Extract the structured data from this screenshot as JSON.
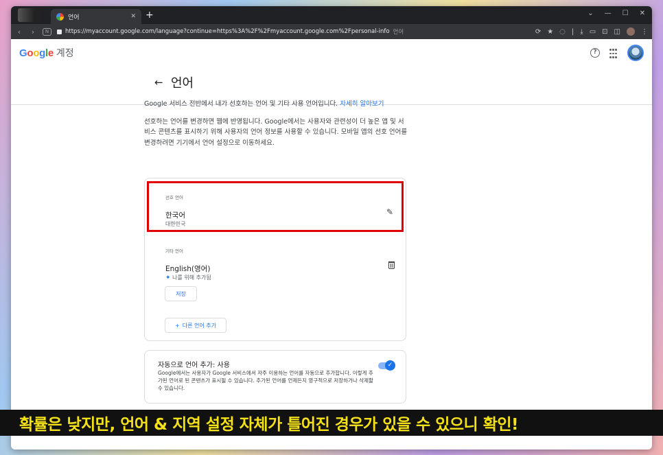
{
  "browser": {
    "tab_title": "언어",
    "new_tab": "+",
    "url": "https://myaccount.google.com/language?continue=https%3A%2F%2Fmyaccount.google.com%2Fpersonal-info",
    "url_suffix": "언어"
  },
  "header": {
    "logo": {
      "G": "G",
      "o1": "o",
      "o2": "o",
      "g": "g",
      "l": "l",
      "e": "e"
    },
    "account": "계정"
  },
  "page": {
    "title": "언어",
    "intro": "Google 서비스 전반에서 내가 선호하는 언어 및 기타 사용 언어입니다.",
    "intro_link": "자세히 알아보기",
    "description": "선호하는 언어를 변경하면 웹에 반영됩니다. Google에서는 사용자와 관련성이 더 높은 앱 및 서비스 콘텐츠를 표시하기 위해 사용자의 언어 정보를 사용할 수 있습니다. 모바일 앱의 선호 언어를 변경하려면 기기에서 언어 설정으로 이동하세요."
  },
  "preferred": {
    "label": "선호 언어",
    "language": "한국어",
    "region": "대한민국"
  },
  "other": {
    "label": "기타 언어",
    "language": "English(영어)",
    "added_note": "나를 위해 추가됨",
    "save_label": "저장",
    "add_label": "다른 언어 추가"
  },
  "auto_add": {
    "title": "자동으로 언어 추가: 사용",
    "description": "Google에서는 사용자가 Google 서비스에서 자주 이용하는 언어를 자동으로 추가합니다. 이렇게 추가된 언어로 된 콘텐츠가 표시될 수 있습니다. 추가된 언어를 언제든지 영구적으로 저장하거나 삭제할 수 있습니다.",
    "enabled": true
  },
  "caption": "확률은 낮지만, 언어 & 지역 설정 자체가 틀어진 경우가 있을 수 있으니 확인!",
  "colors": {
    "accent": "#1a73e8",
    "highlight_box": "#e00000",
    "caption_text": "#f5e11a"
  }
}
